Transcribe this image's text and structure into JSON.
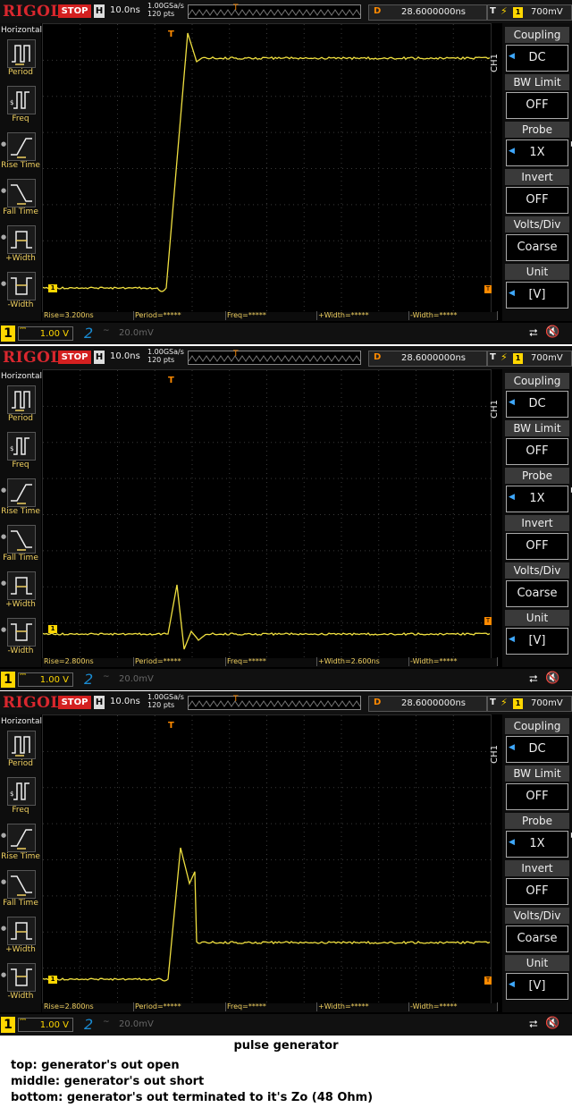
{
  "colors": {
    "trace": "#f0e040",
    "logo": "#d9272e",
    "stop": "#d42020",
    "trigger": "#ff8a00",
    "ch1": "#ffd700",
    "ch2": "#1a8bd2"
  },
  "screens": [
    {
      "id": "top",
      "header": {
        "logo": "RIGOL",
        "run_state": "STOP",
        "h_label": "H",
        "timebase": "10.0ns",
        "sample_rate": "1.00GSa/s",
        "points": "120  pts",
        "d_label": "D",
        "delay": "28.6000000ns",
        "t_label": "T",
        "trig_ch": "1",
        "trig_level": "700mV"
      },
      "left_menu": {
        "title": "Horizontal",
        "items": [
          {
            "label": "Period",
            "icon": "period-icon"
          },
          {
            "label": "Freq",
            "icon": "frequency-icon"
          },
          {
            "label": "Rise Time",
            "icon": "rise-time-icon"
          },
          {
            "label": "Fall Time",
            "icon": "fall-time-icon"
          },
          {
            "label": "+Width",
            "icon": "positive-width-icon"
          },
          {
            "label": "-Width",
            "icon": "negative-width-icon"
          }
        ]
      },
      "right_menu": [
        {
          "title": "Coupling",
          "value": "DC"
        },
        {
          "title": "BW Limit",
          "value": "OFF"
        },
        {
          "title": "Probe",
          "value": "1X"
        },
        {
          "title": "Invert",
          "value": "OFF"
        },
        {
          "title": "Volts/Div",
          "value": "Coarse"
        },
        {
          "title": "Unit",
          "value": "[V]"
        }
      ],
      "ch_label": "CH1",
      "measurements": [
        "Rise=3.200ns",
        "Period=*****",
        "Freq=*****",
        "+Width=*****",
        "-Width=*****"
      ],
      "bottom": {
        "ch1_num": "1",
        "ch1_volt": "1.00 V",
        "ch2_num": "2",
        "ch2_volt": "20.0mV"
      },
      "waveform": "open"
    },
    {
      "id": "middle",
      "header": {
        "logo": "RIGOL",
        "run_state": "STOP",
        "h_label": "H",
        "timebase": "10.0ns",
        "sample_rate": "1.00GSa/s",
        "points": "120  pts",
        "d_label": "D",
        "delay": "28.6000000ns",
        "t_label": "T",
        "trig_ch": "1",
        "trig_level": "700mV"
      },
      "left_menu": {
        "title": "Horizontal",
        "items": [
          {
            "label": "Period",
            "icon": "period-icon"
          },
          {
            "label": "Freq",
            "icon": "frequency-icon"
          },
          {
            "label": "Rise Time",
            "icon": "rise-time-icon"
          },
          {
            "label": "Fall Time",
            "icon": "fall-time-icon"
          },
          {
            "label": "+Width",
            "icon": "positive-width-icon"
          },
          {
            "label": "-Width",
            "icon": "negative-width-icon"
          }
        ]
      },
      "right_menu": [
        {
          "title": "Coupling",
          "value": "DC"
        },
        {
          "title": "BW Limit",
          "value": "OFF"
        },
        {
          "title": "Probe",
          "value": "1X"
        },
        {
          "title": "Invert",
          "value": "OFF"
        },
        {
          "title": "Volts/Div",
          "value": "Coarse"
        },
        {
          "title": "Unit",
          "value": "[V]"
        }
      ],
      "ch_label": "CH1",
      "measurements": [
        "Rise=2.800ns",
        "Period=*****",
        "Freq=*****",
        "+Width=2.600ns",
        "-Width=*****"
      ],
      "bottom": {
        "ch1_num": "1",
        "ch1_volt": "1.00 V",
        "ch2_num": "2",
        "ch2_volt": "20.0mV"
      },
      "waveform": "short"
    },
    {
      "id": "bottom",
      "header": {
        "logo": "RIGOL",
        "run_state": "STOP",
        "h_label": "H",
        "timebase": "10.0ns",
        "sample_rate": "1.00GSa/s",
        "points": "120  pts",
        "d_label": "D",
        "delay": "28.6000000ns",
        "t_label": "T",
        "trig_ch": "1",
        "trig_level": "700mV"
      },
      "left_menu": {
        "title": "Horizontal",
        "items": [
          {
            "label": "Period",
            "icon": "period-icon"
          },
          {
            "label": "Freq",
            "icon": "frequency-icon"
          },
          {
            "label": "Rise Time",
            "icon": "rise-time-icon"
          },
          {
            "label": "Fall Time",
            "icon": "fall-time-icon"
          },
          {
            "label": "+Width",
            "icon": "positive-width-icon"
          },
          {
            "label": "-Width",
            "icon": "negative-width-icon"
          }
        ]
      },
      "right_menu": [
        {
          "title": "Coupling",
          "value": "DC"
        },
        {
          "title": "BW Limit",
          "value": "OFF"
        },
        {
          "title": "Probe",
          "value": "1X"
        },
        {
          "title": "Invert",
          "value": "OFF"
        },
        {
          "title": "Volts/Div",
          "value": "Coarse"
        },
        {
          "title": "Unit",
          "value": "[V]"
        }
      ],
      "ch_label": "CH1",
      "measurements": [
        "Rise=2.800ns",
        "Period=*****",
        "Freq=*****",
        "+Width=*****",
        "-Width=*****"
      ],
      "bottom": {
        "ch1_num": "1",
        "ch1_volt": "1.00 V",
        "ch2_num": "2",
        "ch2_volt": "20.0mV"
      },
      "waveform": "terminated"
    }
  ],
  "caption": {
    "title": "pulse generator",
    "lines": [
      "top: generator's out open",
      "middle: generator's out short",
      "bottom: generator's out terminated to it's Zo (48 Ohm)"
    ]
  }
}
